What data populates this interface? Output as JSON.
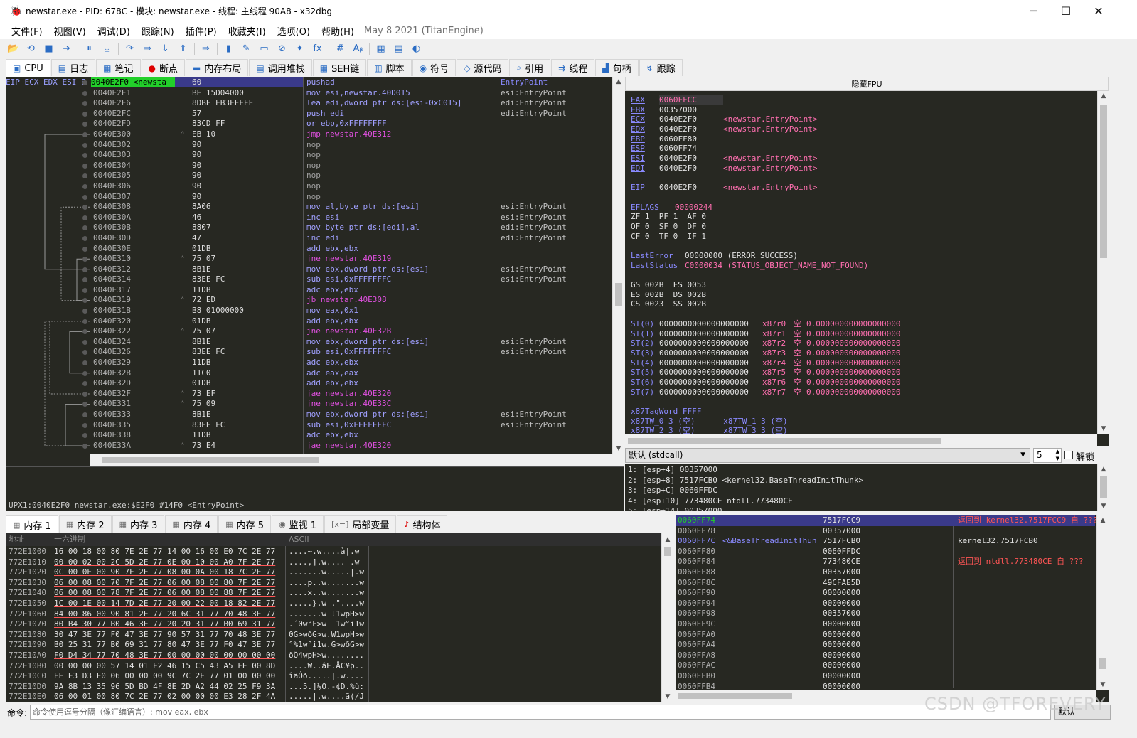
{
  "window": {
    "title": "newstar.exe - PID: 678C - 模块: newstar.exe - 线程: 主线程 90A8 - x32dbg",
    "minimize": "─",
    "maximize": "☐",
    "close": "✕"
  },
  "menu": {
    "items": [
      "文件(F)",
      "视图(V)",
      "调试(D)",
      "跟踪(N)",
      "插件(P)",
      "收藏夹(I)",
      "选项(O)",
      "帮助(H)"
    ],
    "version": "May 8 2021 (TitanEngine)"
  },
  "toolbar": {
    "icons": [
      "📂",
      "⟲",
      "■",
      "➜",
      "⏸",
      "⤓",
      "↷",
      "⇒",
      "⇓",
      "⇑",
      "⇒",
      "▮",
      "✎",
      "▭",
      "⊘",
      "✦",
      "fx",
      "#",
      "Aᵦ",
      "▦",
      "▤",
      "◐"
    ]
  },
  "tabs": [
    {
      "label": "CPU",
      "icon": "▣"
    },
    {
      "label": "日志",
      "icon": "▤"
    },
    {
      "label": "笔记",
      "icon": "▦"
    },
    {
      "label": "断点",
      "icon": "●"
    },
    {
      "label": "内存布局",
      "icon": "▬"
    },
    {
      "label": "调用堆栈",
      "icon": "▤"
    },
    {
      "label": "SEH链",
      "icon": "▦"
    },
    {
      "label": "脚本",
      "icon": "▥"
    },
    {
      "label": "符号",
      "icon": "◉"
    },
    {
      "label": "源代码",
      "icon": "◇"
    },
    {
      "label": "引用",
      "icon": "⌕"
    },
    {
      "label": "线程",
      "icon": "⇉"
    },
    {
      "label": "句柄",
      "icon": "▟"
    },
    {
      "label": "跟踪",
      "icon": "↯"
    }
  ],
  "disasm": {
    "header": "EIP ECX EDX ESI E",
    "eip_label": "0040E2F0 <newsta",
    "rows": [
      {
        "addr": "0040E2F0",
        "bytes": "60",
        "instr": "pushad",
        "cmt": "EntryPoint"
      },
      {
        "addr": "0040E2F1",
        "bytes": "BE 15D04000",
        "instr": "mov esi,newstar.40D015",
        "cmt": "esi:EntryPoint"
      },
      {
        "addr": "0040E2F6",
        "bytes": "8DBE EB3FFFFF",
        "instr": "lea edi,dword ptr ds:[esi-0xC015]",
        "cmt": "edi:EntryPoint"
      },
      {
        "addr": "0040E2FC",
        "bytes": "57",
        "instr": "push edi",
        "cmt": "edi:EntryPoint"
      },
      {
        "addr": "0040E2FD",
        "bytes": "83CD FF",
        "instr": "or ebp,0xFFFFFFFF",
        "cmt": ""
      },
      {
        "addr": "0040E300",
        "bytes": "EB 10",
        "instr": "jmp newstar.40E312",
        "cmt": ""
      },
      {
        "addr": "0040E302",
        "bytes": "90",
        "instr": "nop",
        "cmt": ""
      },
      {
        "addr": "0040E303",
        "bytes": "90",
        "instr": "nop",
        "cmt": ""
      },
      {
        "addr": "0040E304",
        "bytes": "90",
        "instr": "nop",
        "cmt": ""
      },
      {
        "addr": "0040E305",
        "bytes": "90",
        "instr": "nop",
        "cmt": ""
      },
      {
        "addr": "0040E306",
        "bytes": "90",
        "instr": "nop",
        "cmt": ""
      },
      {
        "addr": "0040E307",
        "bytes": "90",
        "instr": "nop",
        "cmt": ""
      },
      {
        "addr": "0040E308",
        "bytes": "8A06",
        "instr": "mov al,byte ptr ds:[esi]",
        "cmt": "esi:EntryPoint"
      },
      {
        "addr": "0040E30A",
        "bytes": "46",
        "instr": "inc esi",
        "cmt": "esi:EntryPoint"
      },
      {
        "addr": "0040E30B",
        "bytes": "8807",
        "instr": "mov byte ptr ds:[edi],al",
        "cmt": "edi:EntryPoint"
      },
      {
        "addr": "0040E30D",
        "bytes": "47",
        "instr": "inc edi",
        "cmt": "edi:EntryPoint"
      },
      {
        "addr": "0040E30E",
        "bytes": "01DB",
        "instr": "add ebx,ebx",
        "cmt": ""
      },
      {
        "addr": "0040E310",
        "bytes": "75 07",
        "instr": "jne newstar.40E319",
        "cmt": ""
      },
      {
        "addr": "0040E312",
        "bytes": "8B1E",
        "instr": "mov ebx,dword ptr ds:[esi]",
        "cmt": "esi:EntryPoint"
      },
      {
        "addr": "0040E314",
        "bytes": "83EE FC",
        "instr": "sub esi,0xFFFFFFFC",
        "cmt": "esi:EntryPoint"
      },
      {
        "addr": "0040E317",
        "bytes": "11DB",
        "instr": "adc ebx,ebx",
        "cmt": ""
      },
      {
        "addr": "0040E319",
        "bytes": "72 ED",
        "instr": "jb newstar.40E308",
        "cmt": ""
      },
      {
        "addr": "0040E31B",
        "bytes": "B8 01000000",
        "instr": "mov eax,0x1",
        "cmt": ""
      },
      {
        "addr": "0040E320",
        "bytes": "01DB",
        "instr": "add ebx,ebx",
        "cmt": ""
      },
      {
        "addr": "0040E322",
        "bytes": "75 07",
        "instr": "jne newstar.40E32B",
        "cmt": ""
      },
      {
        "addr": "0040E324",
        "bytes": "8B1E",
        "instr": "mov ebx,dword ptr ds:[esi]",
        "cmt": "esi:EntryPoint"
      },
      {
        "addr": "0040E326",
        "bytes": "83EE FC",
        "instr": "sub esi,0xFFFFFFFC",
        "cmt": "esi:EntryPoint"
      },
      {
        "addr": "0040E329",
        "bytes": "11DB",
        "instr": "adc ebx,ebx",
        "cmt": ""
      },
      {
        "addr": "0040E32B",
        "bytes": "11C0",
        "instr": "adc eax,eax",
        "cmt": ""
      },
      {
        "addr": "0040E32D",
        "bytes": "01DB",
        "instr": "add ebx,ebx",
        "cmt": ""
      },
      {
        "addr": "0040E32F",
        "bytes": "73 EF",
        "instr": "jae newstar.40E320",
        "cmt": ""
      },
      {
        "addr": "0040E331",
        "bytes": "75 09",
        "instr": "jne newstar.40E33C",
        "cmt": ""
      },
      {
        "addr": "0040E333",
        "bytes": "8B1E",
        "instr": "mov ebx,dword ptr ds:[esi]",
        "cmt": "esi:EntryPoint"
      },
      {
        "addr": "0040E335",
        "bytes": "83EE FC",
        "instr": "sub esi,0xFFFFFFFC",
        "cmt": "esi:EntryPoint"
      },
      {
        "addr": "0040E338",
        "bytes": "11DB",
        "instr": "adc ebx,ebx",
        "cmt": ""
      },
      {
        "addr": "0040E33A",
        "bytes": "73 E4",
        "instr": "jae newstar.40E320",
        "cmt": ""
      }
    ],
    "status": "UPX1:0040E2F0 newstar.exe:$E2F0 #14F0 <EntryPoint>"
  },
  "registers": {
    "toggle_label": "隐藏FPU",
    "general": [
      {
        "name": "EAX",
        "value": "0060FFCC",
        "note": ""
      },
      {
        "name": "EBX",
        "value": "00357000",
        "note": ""
      },
      {
        "name": "ECX",
        "value": "0040E2F0",
        "note": "<newstar.EntryPoint>"
      },
      {
        "name": "EDX",
        "value": "0040E2F0",
        "note": "<newstar.EntryPoint>"
      },
      {
        "name": "EBP",
        "value": "0060FF80",
        "note": ""
      },
      {
        "name": "ESP",
        "value": "0060FF74",
        "note": ""
      },
      {
        "name": "ESI",
        "value": "0040E2F0",
        "note": "<newstar.EntryPoint>"
      },
      {
        "name": "EDI",
        "value": "0040E2F0",
        "note": "<newstar.EntryPoint>"
      }
    ],
    "eip": {
      "name": "EIP",
      "value": "0040E2F0",
      "note": "<newstar.EntryPoint>"
    },
    "eflags": {
      "name": "EFLAGS",
      "value": "00000244"
    },
    "flags": [
      "ZF 1  PF 1  AF 0",
      "OF 0  SF 0  DF 0",
      "CF 0  TF 0  IF 1"
    ],
    "last_error": {
      "name": "LastError",
      "value": "00000000 (ERROR_SUCCESS)"
    },
    "last_status": {
      "name": "LastStatus",
      "value": "C0000034 (STATUS_OBJECT_NAME_NOT_FOUND)"
    },
    "segments": [
      "GS 002B  FS 0053",
      "ES 002B  DS 002B",
      "CS 0023  SS 002B"
    ],
    "fpu": [
      {
        "name": "ST(0)",
        "value": "0000000000000000000",
        "tag": "x87r0",
        "state": "空",
        "fval": "0.000000000000000000"
      },
      {
        "name": "ST(1)",
        "value": "0000000000000000000",
        "tag": "x87r1",
        "state": "空",
        "fval": "0.000000000000000000"
      },
      {
        "name": "ST(2)",
        "value": "0000000000000000000",
        "tag": "x87r2",
        "state": "空",
        "fval": "0.000000000000000000"
      },
      {
        "name": "ST(3)",
        "value": "0000000000000000000",
        "tag": "x87r3",
        "state": "空",
        "fval": "0.000000000000000000"
      },
      {
        "name": "ST(4)",
        "value": "0000000000000000000",
        "tag": "x87r4",
        "state": "空",
        "fval": "0.000000000000000000"
      },
      {
        "name": "ST(5)",
        "value": "0000000000000000000",
        "tag": "x87r5",
        "state": "空",
        "fval": "0.000000000000000000"
      },
      {
        "name": "ST(6)",
        "value": "0000000000000000000",
        "tag": "x87r6",
        "state": "空",
        "fval": "0.000000000000000000"
      },
      {
        "name": "ST(7)",
        "value": "0000000000000000000",
        "tag": "x87r7",
        "state": "空",
        "fval": "0.000000000000000000"
      }
    ],
    "tagword": "x87TagWord FFFF",
    "tw_rows": [
      "x87TW_0 3 (空)      x87TW_1 3 (空)",
      "x87TW_2 3 (空)      x87TW_3 3 (空)"
    ]
  },
  "callconv": {
    "selected": "默认 (stdcall)",
    "count": "5",
    "unlock_label": "解锁",
    "args": [
      "1: [esp+4] 00357000",
      "2: [esp+8] 7517FCB0 <kernel32.BaseThreadInitThunk>",
      "3: [esp+C] 0060FFDC",
      "4: [esp+10] 773480CE ntdll.773480CE",
      "5: [esp+14] 00357000"
    ]
  },
  "bottom_tabs": [
    {
      "label": "内存 1",
      "icon": "▦"
    },
    {
      "label": "内存 2",
      "icon": "▦"
    },
    {
      "label": "内存 3",
      "icon": "▦"
    },
    {
      "label": "内存 4",
      "icon": "▦"
    },
    {
      "label": "内存 5",
      "icon": "▦"
    },
    {
      "label": "监视 1",
      "icon": "◉"
    },
    {
      "label": "局部变量",
      "icon": "[x=]"
    },
    {
      "label": "结构体",
      "icon": "♪"
    }
  ],
  "dump": {
    "headers": {
      "addr": "地址",
      "hex": "十六进制",
      "ascii": "ASCII"
    },
    "rows": [
      {
        "addr": "772E1000",
        "hex": "16 00 18 00 80 7E 2E 77 14 00 16 00 E0 7C 2E 77",
        "ascii": "....~.w....à|.w"
      },
      {
        "addr": "772E1010",
        "hex": "00 00 02 00 2C 5D 2E 77 0E 00 10 00 A0 7F 2E 77",
        "ascii": "....,].w.... .w"
      },
      {
        "addr": "772E1020",
        "hex": "0C 00 0E 00 90 7F 2E 77 08 00 0A 00 18 7C 2E 77",
        "ascii": ".......w.....|.w"
      },
      {
        "addr": "772E1030",
        "hex": "06 00 08 00 70 7F 2E 77 06 00 08 00 80 7F 2E 77",
        "ascii": "....p..w.......w"
      },
      {
        "addr": "772E1040",
        "hex": "06 00 08 00 78 7F 2E 77 06 00 08 00 88 7F 2E 77",
        "ascii": "....x..w.......w"
      },
      {
        "addr": "772E1050",
        "hex": "1C 00 1E 00 14 7D 2E 77 20 00 22 00 18 82 2E 77",
        "ascii": ".....}.w .\"....w"
      },
      {
        "addr": "772E1060",
        "hex": "84 00 86 00 90 81 2E 77 20 6C 31 77 70 48 3E 77",
        "ascii": ".......w l1wpH>w"
      },
      {
        "addr": "772E1070",
        "hex": "80 B4 30 77 B0 46 3E 77 20 20 31 77 B0 69 31 77",
        "ascii": ".´0w°F>w  1w°i1w"
      },
      {
        "addr": "772E1080",
        "hex": "30 47 3E 77 F0 47 3E 77 90 57 31 77 70 48 3E 77",
        "ascii": "0G>wðG>w.W1wpH>w"
      },
      {
        "addr": "772E1090",
        "hex": "B0 25 31 77 B0 69 31 77 80 47 3E 77 F0 47 3E 77",
        "ascii": "°%1w°i1w.G>wðG>w"
      },
      {
        "addr": "772E10A0",
        "hex": "F0 D4 34 77 70 48 3E 77 00 00 00 00 00 00 00 00",
        "ascii": "ðÔ4wpH>w........"
      },
      {
        "addr": "772E10B0",
        "hex": "00 00 00 00 57 14 01 E2 46 15 C5 43 A5 FE 00 8D",
        "ascii": "....W..âF.ÅC¥þ.."
      },
      {
        "addr": "772E10C0",
        "hex": "EE E3 D3 F0 06 00 00 00 9C 7C 2E 77 01 00 00 00",
        "ascii": "îãÓð.....|.w...."
      },
      {
        "addr": "772E10D0",
        "hex": "9A 8B 13 35 96 5D BD 4F 8E 2D A2 44 02 25 F9 3A",
        "ascii": "...5.]½O.-¢D.%ù:"
      },
      {
        "addr": "772E10E0",
        "hex": "06 00 01 00 80 7C 2E 77 02 00 00 00 E3 28 2F 4A",
        "ascii": ".....|.w....ã(/J"
      }
    ]
  },
  "stack": {
    "rows": [
      {
        "addr": "0060FF74",
        "value": "7517FCC9",
        "cmt": "返回到 kernel32.7517FCC9 自 ???",
        "label": ""
      },
      {
        "addr": "0060FF78",
        "value": "00357000",
        "cmt": "",
        "label": ""
      },
      {
        "addr": "0060FF7C",
        "value": "7517FCB0",
        "cmt": "kernel32.7517FCB0",
        "label": "<&BaseThreadInitThun"
      },
      {
        "addr": "0060FF80",
        "value": "0060FFDC",
        "cmt": "",
        "label": ""
      },
      {
        "addr": "0060FF84",
        "value": "773480CE",
        "cmt": "返回到 ntdll.773480CE 自 ???",
        "label": ""
      },
      {
        "addr": "0060FF88",
        "value": "00357000",
        "cmt": "",
        "label": ""
      },
      {
        "addr": "0060FF8C",
        "value": "49CFAE5D",
        "cmt": "",
        "label": ""
      },
      {
        "addr": "0060FF90",
        "value": "00000000",
        "cmt": "",
        "label": ""
      },
      {
        "addr": "0060FF94",
        "value": "00000000",
        "cmt": "",
        "label": ""
      },
      {
        "addr": "0060FF98",
        "value": "00357000",
        "cmt": "",
        "label": ""
      },
      {
        "addr": "0060FF9C",
        "value": "00000000",
        "cmt": "",
        "label": ""
      },
      {
        "addr": "0060FFA0",
        "value": "00000000",
        "cmt": "",
        "label": ""
      },
      {
        "addr": "0060FFA4",
        "value": "00000000",
        "cmt": "",
        "label": ""
      },
      {
        "addr": "0060FFA8",
        "value": "00000000",
        "cmt": "",
        "label": ""
      },
      {
        "addr": "0060FFAC",
        "value": "00000000",
        "cmt": "",
        "label": ""
      },
      {
        "addr": "0060FFB0",
        "value": "00000000",
        "cmt": "",
        "label": ""
      },
      {
        "addr": "0060FFB4",
        "value": "00000000",
        "cmt": "",
        "label": ""
      }
    ]
  },
  "command": {
    "label": "命令:",
    "placeholder": "命令使用逗号分隔（像汇编语言）: mov eax, ebx",
    "mode": "默认"
  },
  "watermark": "CSDN @TFOREVERY",
  "colors": {
    "bg": "#272822",
    "addr": "#b0b0b0",
    "instr": "#a0a0ff",
    "jump": "#e050e0",
    "reg": "#8a8aff",
    "pink": "#ff6fb0",
    "stack_cmt": "#ff5555",
    "highlight": "#3a3a8a",
    "eip_green": "#22d02a"
  }
}
